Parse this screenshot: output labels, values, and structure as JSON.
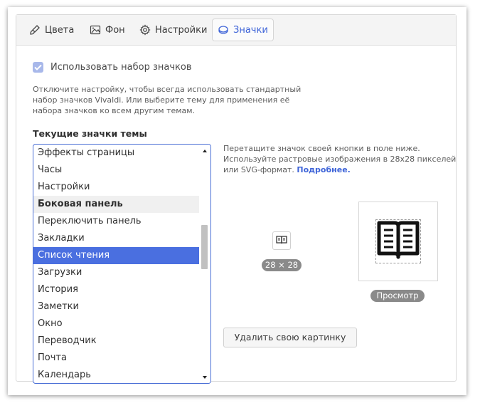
{
  "tabs": [
    {
      "label": "Цвета",
      "icon": "brush-icon"
    },
    {
      "label": "Фон",
      "icon": "image-icon"
    },
    {
      "label": "Настройки",
      "icon": "gear-icon"
    },
    {
      "label": "Значки",
      "icon": "icon-set-icon",
      "active": true
    }
  ],
  "use_icon_set": {
    "label": "Использовать набор значков",
    "checked": true
  },
  "description": "Отключите настройку, чтобы всегда использовать стандартный набор значков Vivaldi. Или выберите тему для применения её набора значков ко всем другим темам.",
  "section_title": "Текущие значки темы",
  "icon_list": {
    "items": [
      {
        "label": "Эффекты страницы",
        "kind": "item"
      },
      {
        "label": "Часы",
        "kind": "item"
      },
      {
        "label": "Настройки",
        "kind": "item"
      },
      {
        "label": "Боковая панель",
        "kind": "header"
      },
      {
        "label": "Переключить панель",
        "kind": "item"
      },
      {
        "label": "Закладки",
        "kind": "item"
      },
      {
        "label": "Список чтения",
        "kind": "selected"
      },
      {
        "label": "Загрузки",
        "kind": "item"
      },
      {
        "label": "История",
        "kind": "item"
      },
      {
        "label": "Заметки",
        "kind": "item"
      },
      {
        "label": "Окно",
        "kind": "item"
      },
      {
        "label": "Переводчик",
        "kind": "item"
      },
      {
        "label": "Почта",
        "kind": "item"
      },
      {
        "label": "Календарь",
        "kind": "item"
      }
    ]
  },
  "hint": {
    "text": "Перетащите значок своей кнопки в поле ниже. Используйте растровые изображения в 28x28 пикселей или SVG-формат.",
    "link": "Подробнее."
  },
  "size_label": "28 × 28",
  "preview_label": "Просмотр",
  "remove_button": "Удалить свою картинку",
  "colors": {
    "accent": "#4a6fe0",
    "active_tab_text": "#3d63d8",
    "checkbox": "#a8b8ea"
  }
}
